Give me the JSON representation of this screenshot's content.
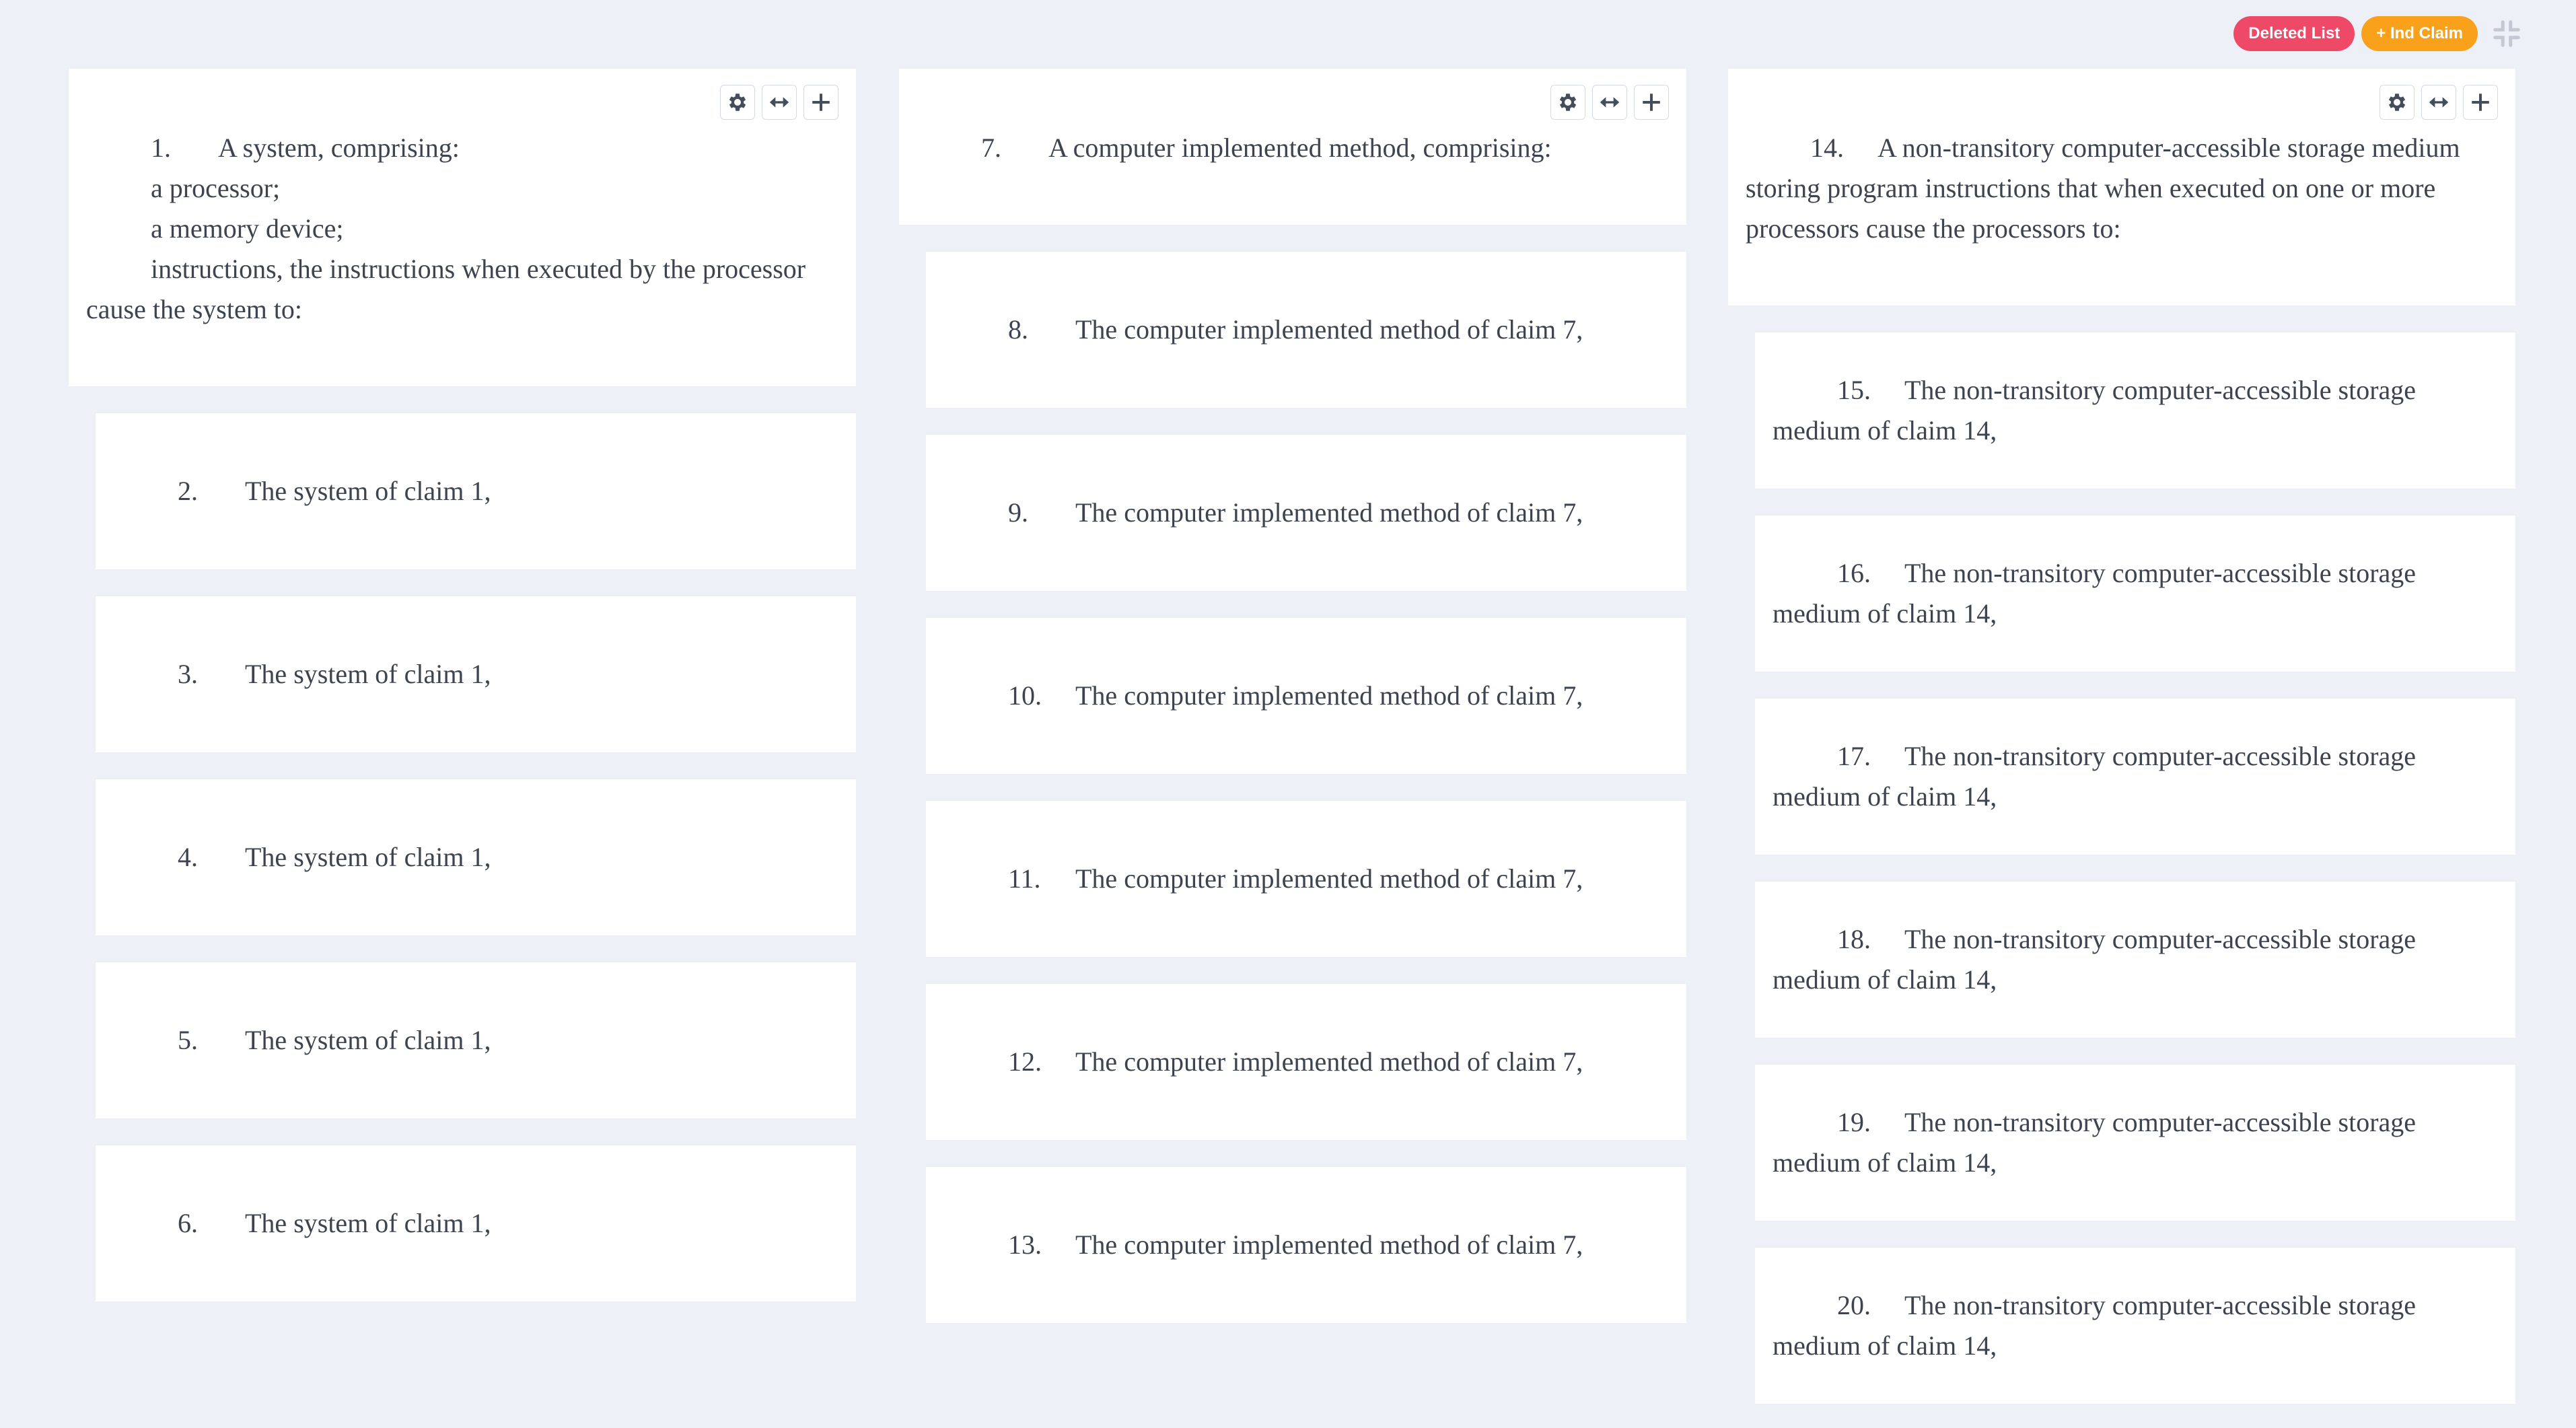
{
  "toolbar": {
    "deleted_list_label": "Deleted List",
    "ind_claim_label": "+ Ind Claim",
    "shrink_icon": "collapse-icon"
  },
  "colors": {
    "background": "#edf0f7",
    "card": "#ffffff",
    "deleted_list": "#ee4a67",
    "ind_claim": "#f9a11b",
    "text": "#3d4450"
  },
  "columns": [
    {
      "independent": {
        "num": "1.",
        "lines": [
          "A system, comprising:",
          "a processor;",
          "a memory device;",
          "instructions, the instructions when executed by the processor cause the system to:"
        ]
      },
      "dependents": [
        {
          "num": "2.",
          "text": "The system of claim 1,"
        },
        {
          "num": "3.",
          "text": "The system of claim 1,"
        },
        {
          "num": "4.",
          "text": "The system of claim 1,"
        },
        {
          "num": "5.",
          "text": "The system of claim 1,"
        },
        {
          "num": "6.",
          "text": "The system of claim 1,"
        }
      ]
    },
    {
      "independent": {
        "num": "7.",
        "lines": [
          "A computer implemented method, comprising:"
        ]
      },
      "dependents": [
        {
          "num": "8.",
          "text": "The computer implemented method of claim 7,"
        },
        {
          "num": "9.",
          "text": "The computer implemented method of claim 7,"
        },
        {
          "num": "10.",
          "text": "The computer implemented method of claim 7,"
        },
        {
          "num": "11.",
          "text": "The computer implemented method of claim 7,"
        },
        {
          "num": "12.",
          "text": "The computer implemented method of claim 7,"
        },
        {
          "num": "13.",
          "text": "The computer implemented method of claim 7,"
        }
      ]
    },
    {
      "independent": {
        "num": "14.",
        "lines": [
          "A non-transitory computer-accessible storage medium storing program instructions that when executed on one or more processors cause the processors to:"
        ]
      },
      "dependents": [
        {
          "num": "15.",
          "text": "The non-transitory computer-accessible storage medium of claim 14,"
        },
        {
          "num": "16.",
          "text": "The non-transitory computer-accessible storage medium of claim 14,"
        },
        {
          "num": "17.",
          "text": "The non-transitory computer-accessible storage medium of claim 14,"
        },
        {
          "num": "18.",
          "text": "The non-transitory computer-accessible storage medium of claim 14,"
        },
        {
          "num": "19.",
          "text": "The non-transitory computer-accessible storage medium of claim 14,"
        },
        {
          "num": "20.",
          "text": "The non-transitory computer-accessible storage medium of claim 14,"
        }
      ]
    }
  ]
}
